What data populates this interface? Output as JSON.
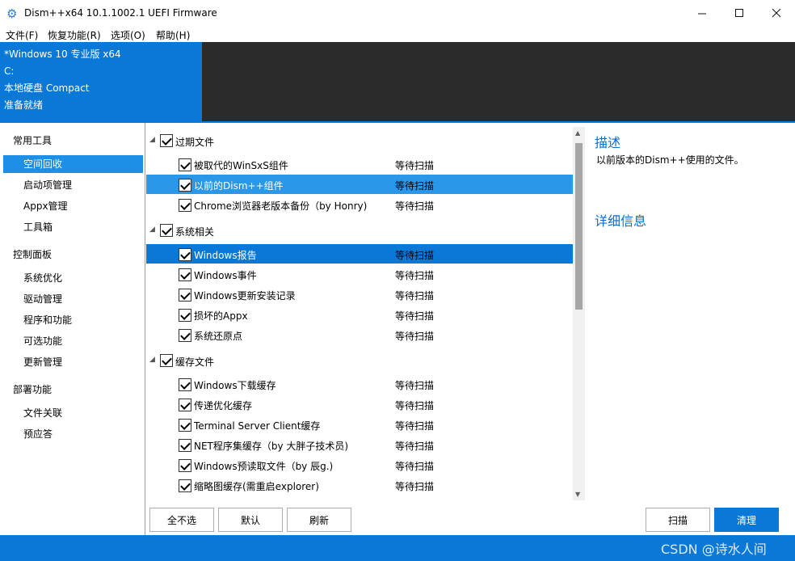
{
  "window": {
    "title": "Dism++x64 10.1.1002.1 UEFI Firmware",
    "app_icon": "gear-icon",
    "minimize": "—",
    "maximize": "☐",
    "close": "✕"
  },
  "menu": [
    "文件(F)",
    "恢复功能(R)",
    "选项(O)",
    "帮助(H)"
  ],
  "info": {
    "os": "*Windows 10 专业版 x64",
    "drive": "C:",
    "disk": "本地硬盘 Compact",
    "status": "准备就绪"
  },
  "sidebar": {
    "groups": [
      {
        "label": "常用工具",
        "items": [
          "空间回收",
          "启动项管理",
          "Appx管理",
          "工具箱"
        ]
      },
      {
        "label": "控制面板",
        "items": [
          "系统优化",
          "驱动管理",
          "程序和功能",
          "可选功能",
          "更新管理"
        ]
      },
      {
        "label": "部署功能",
        "items": [
          "文件关联",
          "预应答"
        ]
      }
    ]
  },
  "list": {
    "groups": [
      {
        "label": "过期文件",
        "items": [
          {
            "label": "被取代的WinSxS组件",
            "status": "等待扫描"
          },
          {
            "label": "以前的Dism++组件",
            "status": "等待扫描"
          },
          {
            "label": "Chrome浏览器老版本备份（by Honry)",
            "status": "等待扫描"
          }
        ]
      },
      {
        "label": "系统相关",
        "items": [
          {
            "label": "Windows报告",
            "status": "等待扫描"
          },
          {
            "label": "Windows事件",
            "status": "等待扫描"
          },
          {
            "label": "Windows更新安装记录",
            "status": "等待扫描"
          },
          {
            "label": "损坏的Appx",
            "status": "等待扫描"
          },
          {
            "label": "系统还原点",
            "status": "等待扫描"
          }
        ]
      },
      {
        "label": "缓存文件",
        "items": [
          {
            "label": "Windows下载缓存",
            "status": "等待扫描"
          },
          {
            "label": "传递优化缓存",
            "status": "等待扫描"
          },
          {
            "label": "Terminal Server Client缓存",
            "status": "等待扫描"
          },
          {
            "label": "NET程序集缓存（by 大胖子技术员)",
            "status": "等待扫描"
          },
          {
            "label": "Windows预读取文件（by 辰g.)",
            "status": "等待扫描"
          },
          {
            "label": "缩略图缓存(需重启explorer)",
            "status": "等待扫描"
          }
        ]
      }
    ]
  },
  "description": {
    "title": "描述",
    "text": "以前版本的Dism++使用的文件。",
    "detail_title": "详细信息"
  },
  "buttons": {
    "deselect_all": "全不选",
    "default": "默认",
    "refresh": "刷新",
    "scan": "扫描",
    "clean": "清理"
  },
  "watermark": "CSDN @诗水人间"
}
